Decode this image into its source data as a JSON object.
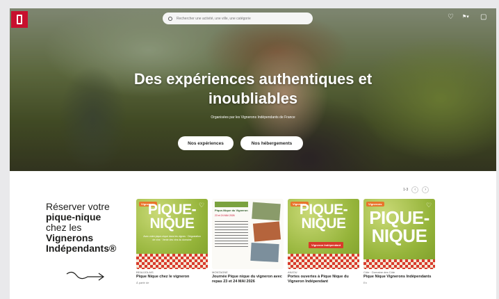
{
  "brand": {
    "logo": "vigneron-logo-icon",
    "accent": "#c8102e"
  },
  "header": {
    "search_placeholder": "Rechercher une activité, une ville, une catégorie",
    "icons": [
      "heart-icon",
      "language-flag-icon",
      "cart-icon"
    ]
  },
  "hero": {
    "title": "Des expériences authentiques et inoubliables",
    "subtitle": "Organisées par les Vignerons Indépendants de France",
    "btn_experiences": "Nos expériences",
    "btn_hebergements": "Nos hébergements"
  },
  "promo": {
    "line1": "Réserver votre",
    "line2": "pique-nique",
    "line3": "chez les",
    "line4": "Vignerons",
    "line5": "Indépendants®"
  },
  "pager": {
    "label": "1-3",
    "prev": "‹",
    "next": "›"
  },
  "cards": [
    {
      "category": "BEAUJOLAIS",
      "title": "Pique Nique chez le vigneron",
      "meta": "À partir de",
      "poster_title": "PIQUE-NIQUE",
      "poster_text": "Avec votre pique-nique dans les vignes · Dégustation de vins · Vente des vins du domaine",
      "badge": "Vignerons"
    },
    {
      "category": "MONTAGNE",
      "title": "Journée Pique nique du vigneron avec repas 23 et 24 MAI 2026",
      "meta": "",
      "poster_title": "Pique-Nique du Vigneron",
      "poster_text": "23 et 24 MAI 2026",
      "badge": ""
    },
    {
      "category": "ANJOU",
      "title": "Portes ouvertes à Pique Nique du Vigneron Indépendant",
      "meta": "",
      "poster_title": "PIQUE-NIQUE",
      "poster_text": "Vigneron Indépendant",
      "badge": "Vignerons"
    },
    {
      "category": "Côte · Domaine des Côte",
      "title": "Pique Nique Vignerons Indépendants",
      "meta": "En",
      "poster_title": "PIQUE-NIQUE",
      "poster_text": "",
      "badge": "Vignerons"
    }
  ]
}
